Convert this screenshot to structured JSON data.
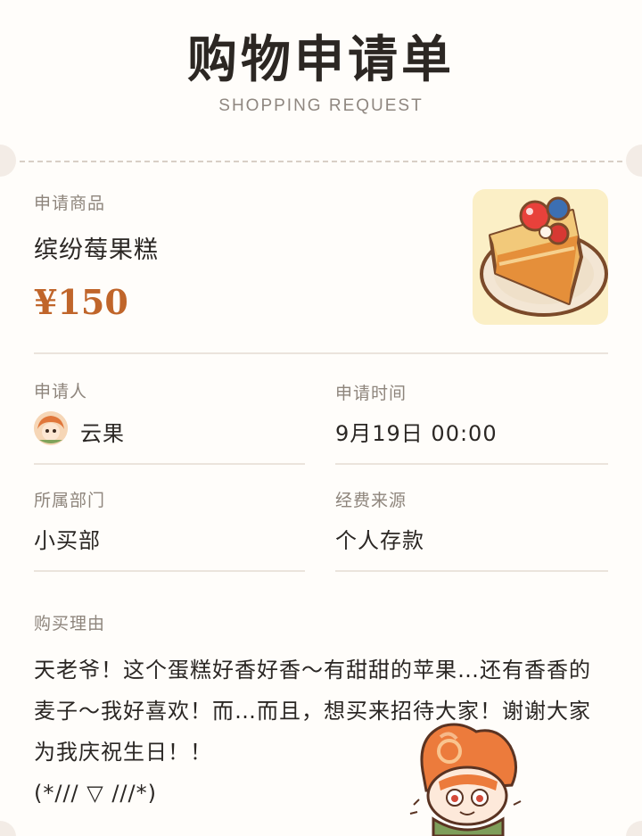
{
  "header": {
    "title": "购物申请单",
    "subtitle": "SHOPPING REQUEST"
  },
  "product": {
    "label": "申请商品",
    "name": "缤纷莓果糕",
    "price": "¥150",
    "image_icon": "berry-cake-image"
  },
  "fields": {
    "applicant_label": "申请人",
    "applicant_name": "云果",
    "time_label": "申请时间",
    "time_value": "9月19日 00:00",
    "department_label": "所属部门",
    "department_value": "小买部",
    "funding_label": "经费来源",
    "funding_value": "个人存款"
  },
  "reason": {
    "label": "购买理由",
    "text": "天老爷！这个蛋糕好香好香～有甜甜的苹果…还有香香的麦子～我好喜欢！而…而且，想买来招待大家！谢谢大家为我庆祝生日！！",
    "emoticon": "(*/// ▽ ///*)"
  },
  "colors": {
    "accent": "#c0652a",
    "label": "#8e857c",
    "text": "#2b2724",
    "background": "#fffdfa"
  }
}
